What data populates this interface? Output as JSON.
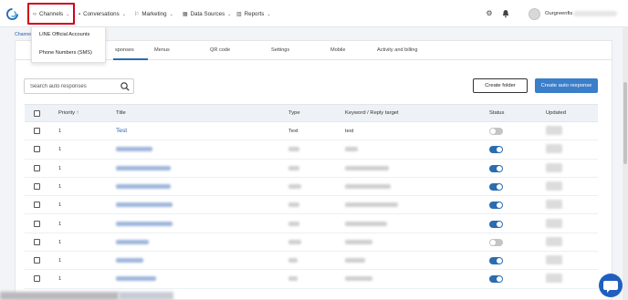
{
  "nav": {
    "items": [
      {
        "label": "Channels"
      },
      {
        "label": "Conversations"
      },
      {
        "label": "Marketing"
      },
      {
        "label": "Data Sources"
      },
      {
        "label": "Reports"
      }
    ],
    "org_name": "Ourgreenfis"
  },
  "dropdown": {
    "items": [
      "LINE Official Accounts",
      "Phone Numbers (SMS)"
    ]
  },
  "breadcrumb": "Channels",
  "tabs": [
    "Auto Responses",
    "Menus",
    "QR code",
    "Settings",
    "Mobile",
    "Activity and billing"
  ],
  "tabs_visible": [
    "sponses",
    "Menus",
    "QR code",
    "Settings",
    "Mobile",
    "Activity and billing"
  ],
  "toolbar": {
    "search_placeholder": "Search auto responses",
    "create_folder": "Create folder",
    "create_auto_response": "Create auto response"
  },
  "table": {
    "headers": {
      "priority": "Priority",
      "title": "Title",
      "type": "Type",
      "keyword": "Keyword / Reply target",
      "status": "Status",
      "updated": "Updated"
    },
    "rows": [
      {
        "priority": "1",
        "title": "Test",
        "type": "Text",
        "keyword": "test",
        "status": "off"
      },
      {
        "priority": "1",
        "title": "",
        "type": "",
        "keyword": "",
        "status": "on"
      },
      {
        "priority": "1",
        "title": "",
        "type": "",
        "keyword": "",
        "status": "on"
      },
      {
        "priority": "1",
        "title": "",
        "type": "",
        "keyword": "",
        "status": "on"
      },
      {
        "priority": "1",
        "title": "",
        "type": "",
        "keyword": "",
        "status": "on"
      },
      {
        "priority": "1",
        "title": "",
        "type": "",
        "keyword": "",
        "status": "on"
      },
      {
        "priority": "1",
        "title": "",
        "type": "",
        "keyword": "",
        "status": "off"
      },
      {
        "priority": "1",
        "title": "",
        "type": "",
        "keyword": "",
        "status": "on"
      },
      {
        "priority": "1",
        "title": "",
        "type": "",
        "keyword": "",
        "status": "on"
      }
    ]
  },
  "colors": {
    "accent": "#3b7ec9",
    "link": "#2a5db0",
    "toggle_on": "#2a6db0",
    "toggle_off": "#c4c4c4",
    "highlight": "#d0021b"
  }
}
